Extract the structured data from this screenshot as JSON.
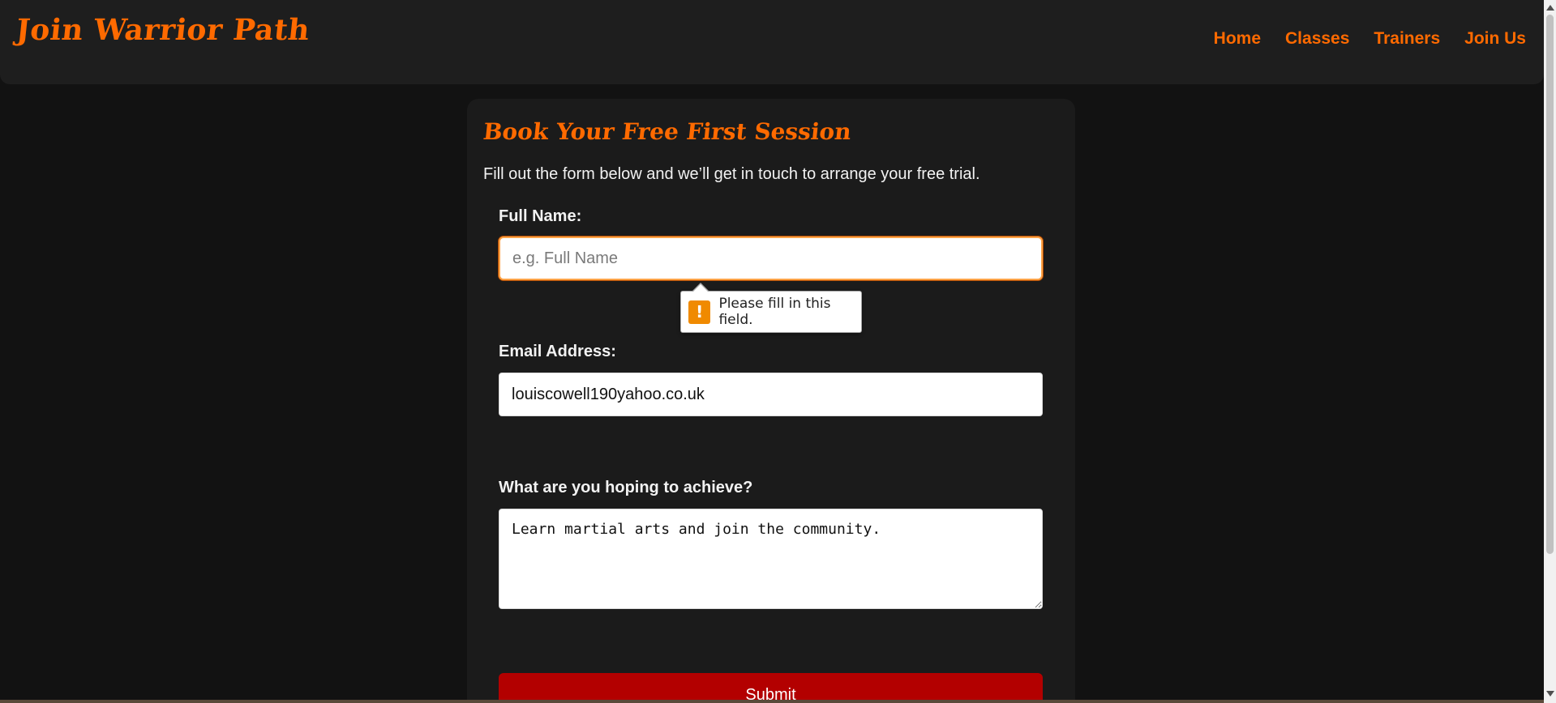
{
  "header": {
    "logo": "Join Warrior Path",
    "nav": [
      {
        "label": "Home"
      },
      {
        "label": "Classes"
      },
      {
        "label": "Trainers"
      },
      {
        "label": "Join Us"
      }
    ]
  },
  "form": {
    "title": "Book Your Free First Session",
    "intro": "Fill out the form below and we’ll get in touch to arrange your free trial.",
    "full_name": {
      "label": "Full Name:",
      "placeholder": "e.g. Full Name",
      "value": ""
    },
    "email": {
      "label": "Email Address:",
      "value": "louiscowell190yahoo.co.uk"
    },
    "goal": {
      "label": "What are you hoping to achieve?",
      "value": "Learn martial arts and join the community."
    },
    "submit_label": "Submit"
  },
  "validation": {
    "icon": "warning-icon",
    "glyph": "!",
    "message": "Please fill in this field."
  },
  "colors": {
    "accent": "#ff6a00",
    "submit": "#b30000",
    "background": "#121212",
    "panel": "#1b1b1b"
  }
}
